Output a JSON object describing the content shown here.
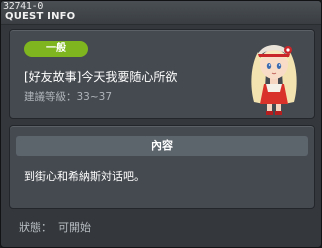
{
  "window": {
    "quest_id": "32741-0",
    "title": "QUEST INFO"
  },
  "quest": {
    "tag": "一般",
    "name": "[好友故事]今天我要随心所欲",
    "level": "建議等級：33~37"
  },
  "content": {
    "header": "內容",
    "text": "到街心和希納斯対话吧。"
  },
  "status": {
    "label": "狀態：",
    "value": "可開始"
  },
  "colors": {
    "tag_green": "#7fb61f",
    "panel": "#454a50",
    "header_bar": "#5d656c"
  }
}
